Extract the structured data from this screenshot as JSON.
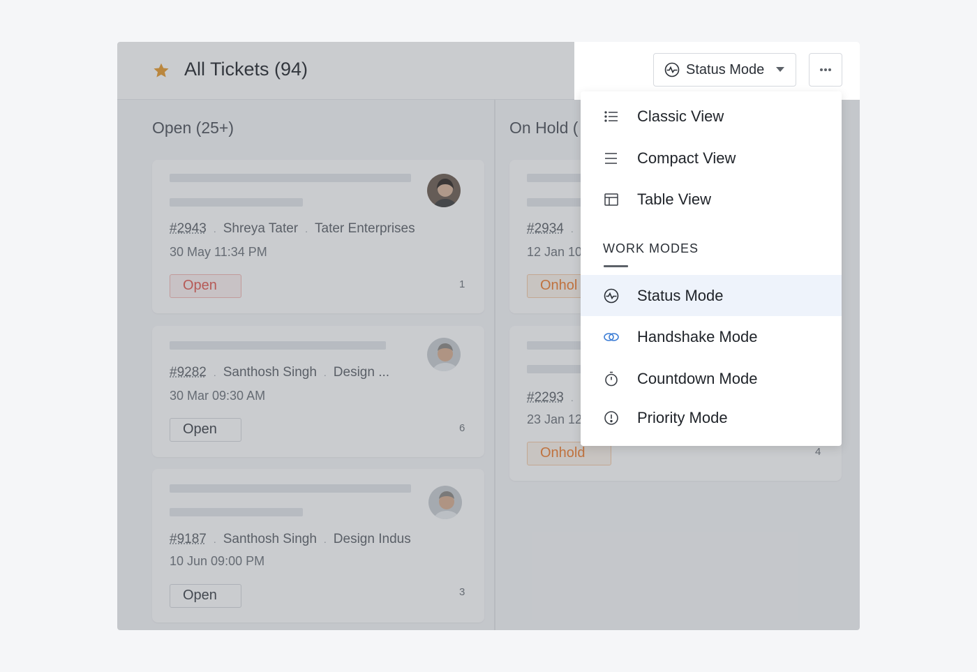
{
  "header": {
    "title": "All Tickets (94)",
    "star_icon": "star-icon",
    "accent_color": "#e89a2c"
  },
  "columns": [
    {
      "title": "Open (25+)",
      "cards": [
        {
          "id": "#2943",
          "contact": "Shreya Tater",
          "account": "Tater Enterprises",
          "date": "30 May 11:34 PM",
          "status": "Open",
          "count": "1"
        },
        {
          "id": "#9282",
          "contact": "Santhosh Singh",
          "account": "Design ...",
          "date": "30 Mar 09:30 AM",
          "status": "Open",
          "count": "6"
        },
        {
          "id": "#9187",
          "contact": "Santhosh Singh",
          "account": "Design Indus",
          "date": "10 Jun 09:00 PM",
          "status": "Open",
          "count": "3"
        }
      ]
    },
    {
      "title": "On Hold (",
      "cards": [
        {
          "id": "#2934",
          "date": "12 Jan 10",
          "status": "Onhol",
          "count": ""
        },
        {
          "id": "#2293",
          "date": "23 Jan 12",
          "status": "Onhold",
          "count": "4"
        }
      ]
    }
  ],
  "toolbar": {
    "status_mode_label": "Status Mode",
    "more_icon": "more-horizontal-icon"
  },
  "menu": {
    "views": [
      {
        "label": "Classic View",
        "icon": "list-icon"
      },
      {
        "label": "Compact View",
        "icon": "lines-icon"
      },
      {
        "label": "Table View",
        "icon": "table-icon"
      }
    ],
    "section_label": "WORK MODES",
    "modes": [
      {
        "label": "Status Mode",
        "icon": "status-icon",
        "active": true
      },
      {
        "label": "Handshake Mode",
        "icon": "handshake-icon",
        "active": false
      },
      {
        "label": "Countdown Mode",
        "icon": "timer-icon",
        "active": false
      },
      {
        "label": "Priority Mode",
        "icon": "priority-icon",
        "active": false
      }
    ]
  }
}
